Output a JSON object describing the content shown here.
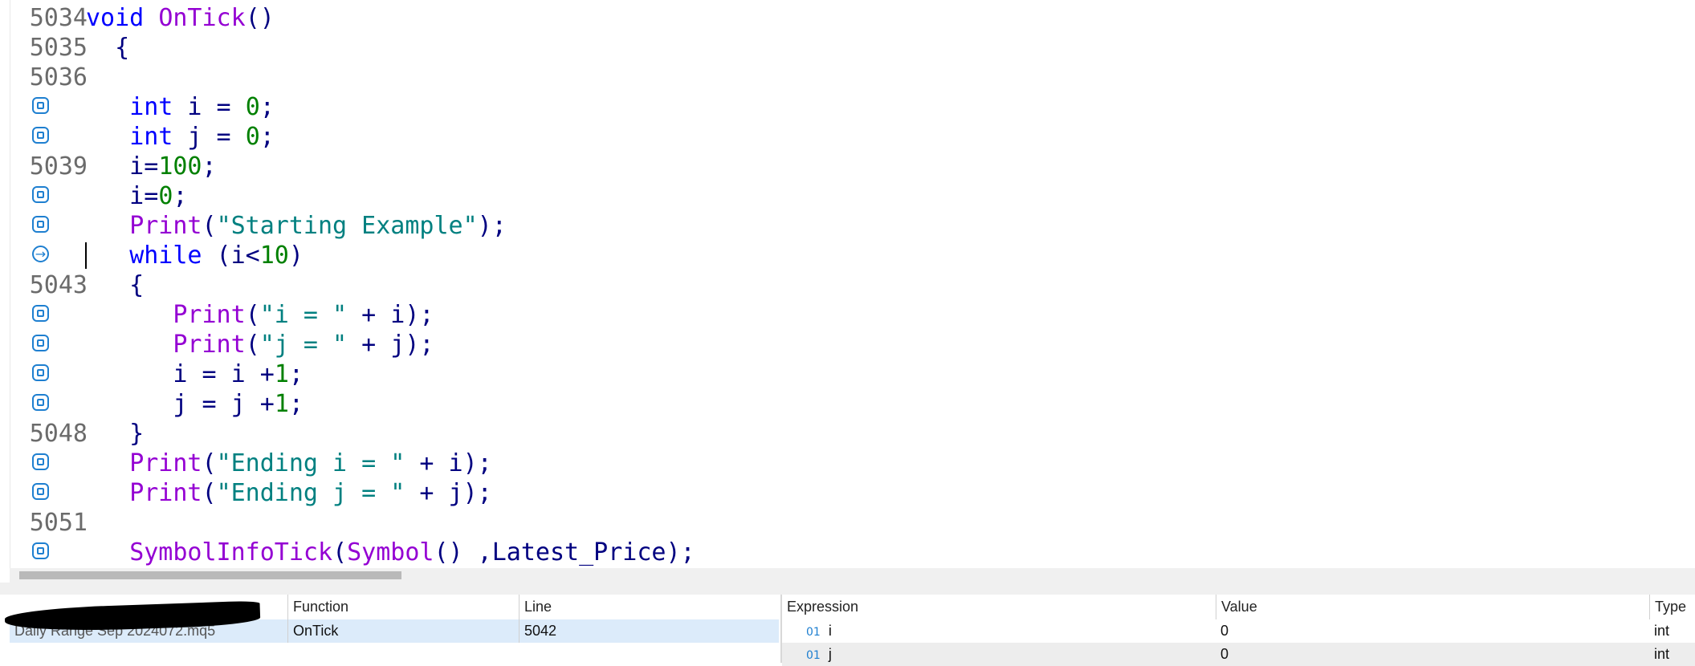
{
  "editor": {
    "lines": [
      {
        "number": "5034",
        "marker": "none",
        "tokens": [
          {
            "t": "void ",
            "c": "kw"
          },
          {
            "t": "OnTick",
            "c": "fn"
          },
          {
            "t": "()",
            "c": "p"
          }
        ]
      },
      {
        "number": "5035",
        "marker": "none",
        "tokens": [
          {
            "t": "  {",
            "c": "p"
          }
        ]
      },
      {
        "number": "5036",
        "marker": "none",
        "tokens": []
      },
      {
        "number": "",
        "marker": "breakpoint",
        "tokens": [
          {
            "t": "   ",
            "c": "p"
          },
          {
            "t": "int",
            "c": "kw"
          },
          {
            "t": " i = ",
            "c": "p"
          },
          {
            "t": "0",
            "c": "num"
          },
          {
            "t": ";",
            "c": "p"
          }
        ]
      },
      {
        "number": "",
        "marker": "breakpoint",
        "tokens": [
          {
            "t": "   ",
            "c": "p"
          },
          {
            "t": "int",
            "c": "kw"
          },
          {
            "t": " j = ",
            "c": "p"
          },
          {
            "t": "0",
            "c": "num"
          },
          {
            "t": ";",
            "c": "p"
          }
        ]
      },
      {
        "number": "5039",
        "marker": "none",
        "tokens": [
          {
            "t": "   i=",
            "c": "p"
          },
          {
            "t": "100",
            "c": "num"
          },
          {
            "t": ";",
            "c": "p"
          }
        ]
      },
      {
        "number": "",
        "marker": "breakpoint",
        "tokens": [
          {
            "t": "   i=",
            "c": "p"
          },
          {
            "t": "0",
            "c": "num"
          },
          {
            "t": ";",
            "c": "p"
          }
        ]
      },
      {
        "number": "",
        "marker": "breakpoint",
        "tokens": [
          {
            "t": "   ",
            "c": "p"
          },
          {
            "t": "Print",
            "c": "fn"
          },
          {
            "t": "(",
            "c": "p"
          },
          {
            "t": "\"Starting Example\"",
            "c": "str"
          },
          {
            "t": ");",
            "c": "p"
          }
        ]
      },
      {
        "number": "",
        "marker": "current",
        "tokens": [
          {
            "t": "   ",
            "c": "p"
          },
          {
            "t": "while",
            "c": "kw"
          },
          {
            "t": " (i<",
            "c": "p"
          },
          {
            "t": "10",
            "c": "num"
          },
          {
            "t": ")",
            "c": "p"
          }
        ]
      },
      {
        "number": "5043",
        "marker": "none",
        "tokens": [
          {
            "t": "   {",
            "c": "p"
          }
        ]
      },
      {
        "number": "",
        "marker": "breakpoint",
        "tokens": [
          {
            "t": "      ",
            "c": "p"
          },
          {
            "t": "Print",
            "c": "fn"
          },
          {
            "t": "(",
            "c": "p"
          },
          {
            "t": "\"i = \"",
            "c": "str"
          },
          {
            "t": " + i);",
            "c": "p"
          }
        ]
      },
      {
        "number": "",
        "marker": "breakpoint",
        "tokens": [
          {
            "t": "      ",
            "c": "p"
          },
          {
            "t": "Print",
            "c": "fn"
          },
          {
            "t": "(",
            "c": "p"
          },
          {
            "t": "\"j = \"",
            "c": "str"
          },
          {
            "t": " + j);",
            "c": "p"
          }
        ]
      },
      {
        "number": "",
        "marker": "breakpoint",
        "tokens": [
          {
            "t": "      i = i +",
            "c": "p"
          },
          {
            "t": "1",
            "c": "num"
          },
          {
            "t": ";",
            "c": "p"
          }
        ]
      },
      {
        "number": "",
        "marker": "breakpoint",
        "tokens": [
          {
            "t": "      j = j +",
            "c": "p"
          },
          {
            "t": "1",
            "c": "num"
          },
          {
            "t": ";",
            "c": "p"
          }
        ]
      },
      {
        "number": "5048",
        "marker": "none",
        "tokens": [
          {
            "t": "   }",
            "c": "p"
          }
        ]
      },
      {
        "number": "",
        "marker": "breakpoint",
        "tokens": [
          {
            "t": "   ",
            "c": "p"
          },
          {
            "t": "Print",
            "c": "fn"
          },
          {
            "t": "(",
            "c": "p"
          },
          {
            "t": "\"Ending i = \"",
            "c": "str"
          },
          {
            "t": " + i);",
            "c": "p"
          }
        ]
      },
      {
        "number": "",
        "marker": "breakpoint",
        "tokens": [
          {
            "t": "   ",
            "c": "p"
          },
          {
            "t": "Print",
            "c": "fn"
          },
          {
            "t": "(",
            "c": "p"
          },
          {
            "t": "\"Ending j = \"",
            "c": "str"
          },
          {
            "t": " + j);",
            "c": "p"
          }
        ]
      },
      {
        "number": "5051",
        "marker": "none",
        "tokens": []
      },
      {
        "number": "",
        "marker": "breakpoint",
        "tokens": [
          {
            "t": "   ",
            "c": "p"
          },
          {
            "t": "SymbolInfoTick",
            "c": "fn"
          },
          {
            "t": "(",
            "c": "p"
          },
          {
            "t": "Symbol",
            "c": "fn"
          },
          {
            "t": "() ,Latest_Price);",
            "c": "p"
          }
        ]
      }
    ]
  },
  "callstack": {
    "headers": {
      "file": "",
      "function": "Function",
      "line": "Line"
    },
    "rows": [
      {
        "file": "Daily Range Sep 2024072.mq5",
        "function": "OnTick",
        "line": "5042"
      }
    ]
  },
  "watch": {
    "headers": {
      "expression": "Expression",
      "value": "Value",
      "type": "Type"
    },
    "rows": [
      {
        "icon": "variable-icon",
        "expression": "i",
        "value": "0",
        "type": "int"
      },
      {
        "icon": "variable-icon",
        "expression": "j",
        "value": "0",
        "type": "int"
      }
    ]
  },
  "colors": {
    "keyword": "#0000ff",
    "function": "#9400d3",
    "number": "#008000",
    "string": "#008080",
    "plain": "#000080",
    "breakpoint": "#1e7fd0",
    "selection": "#dcebfa"
  }
}
